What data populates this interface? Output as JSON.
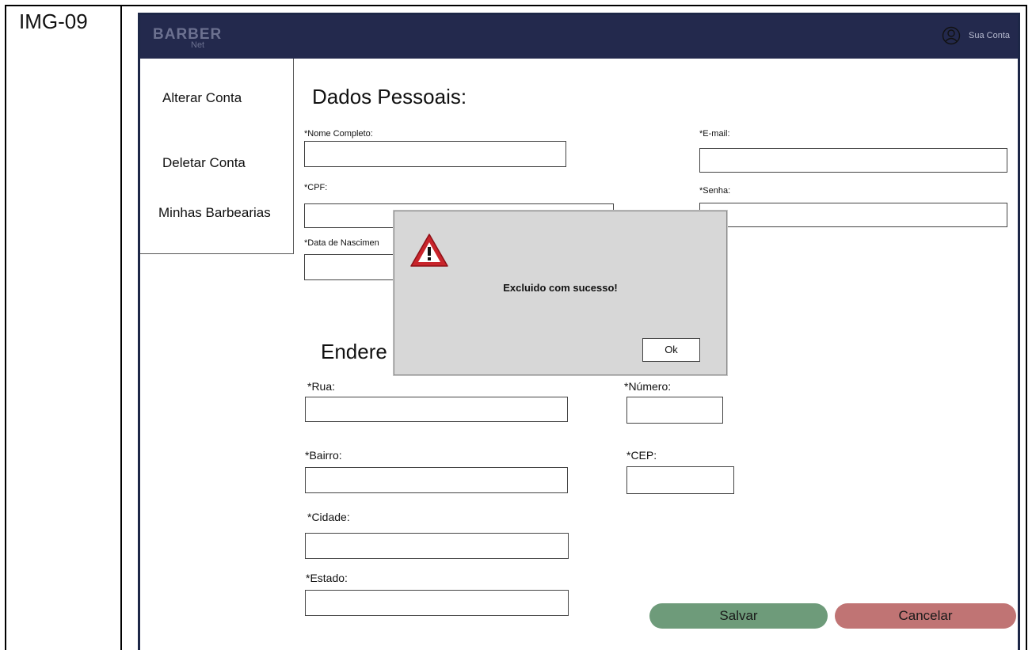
{
  "doc": {
    "id_label": "IMG-09"
  },
  "header": {
    "logo_text": "BARBER",
    "logo_sub": "Net",
    "account_label": "Sua Conta"
  },
  "sidebar": {
    "items": [
      {
        "label": "Alterar Conta"
      },
      {
        "label": "Deletar Conta"
      },
      {
        "label": "Minhas Barbearias"
      }
    ]
  },
  "personal": {
    "title": "Dados Pessoais:",
    "name_label": "*Nome Completo:",
    "email_label": "*E-mail:",
    "cpf_label": "*CPF:",
    "password_label": "*Senha:",
    "birth_label": "*Data de Nascimen"
  },
  "address": {
    "title": "Endere",
    "street_label": "*Rua:",
    "number_label": "*Número:",
    "district_label": "*Bairro:",
    "zip_label": "*CEP:",
    "city_label": "*Cidade:",
    "state_label": "*Estado:"
  },
  "actions": {
    "save_label": "Salvar",
    "cancel_label": "Cancelar",
    "save_color": "#6e9b7a",
    "cancel_color": "#c07474"
  },
  "dialog": {
    "icon": "warning-icon",
    "message": "Excluido com sucesso!",
    "ok_label": "Ok"
  },
  "colors": {
    "header_bg": "#23294d"
  }
}
